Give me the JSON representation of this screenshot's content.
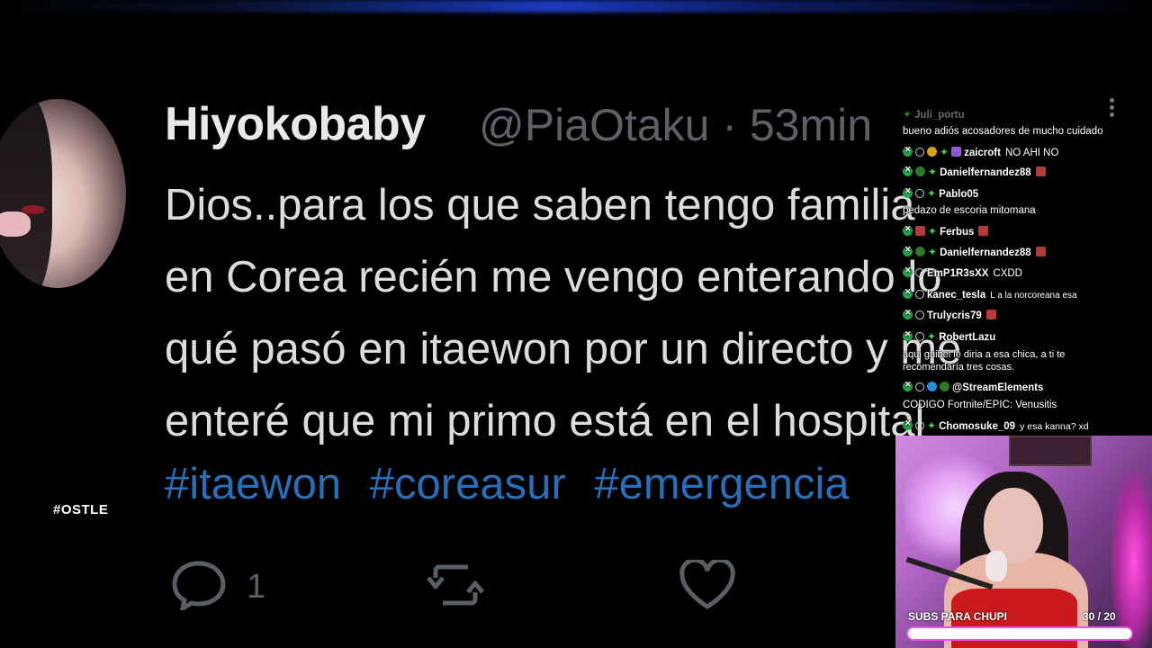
{
  "tweet": {
    "display_name": "Hiyokobaby",
    "handle_time": "@PiaOtaku · 53min",
    "lines": [
      "Dios..para los que saben tengo familia",
      "en Corea recién me vengo enterando lo",
      "qué pasó en itaewon por un directo y me",
      "enteré que mi primo está en el hospital"
    ],
    "hashtags": [
      "#itaewon",
      "#coreasur",
      "#emergencia"
    ],
    "reply_count": "1",
    "icons": [
      "reply-icon",
      "retweet-icon",
      "like-icon"
    ]
  },
  "side_tag": "#OSTLE",
  "chat": {
    "messages": [
      {
        "user": "Juli_portu",
        "text": ""
      },
      {
        "user": "",
        "text": "bueno adiós acosadores de mucho cuidado"
      },
      {
        "user": "zaicroft",
        "text": "NO AHI NO"
      },
      {
        "user": "Danielfernandez88",
        "text": ""
      },
      {
        "user": "Pablo05",
        "text": ""
      },
      {
        "user": "",
        "text": "pedazo de escoria mitomana"
      },
      {
        "user": "Ferbus",
        "text": ""
      },
      {
        "user": "Danielfernandez88",
        "text": ""
      },
      {
        "user": "EmP1R3sXX",
        "text": "CXDD"
      },
      {
        "user": "kanec_tesla",
        "text": "L a la norcoreana esa"
      },
      {
        "user": "Trulycris79",
        "text": ""
      },
      {
        "user": "RobertLazu",
        "text": ""
      },
      {
        "user": "",
        "text": "aqui guibel le diria a esa chica, a ti te"
      },
      {
        "user": "",
        "text": "recomendaría tres cosas."
      },
      {
        "user": "@StreamElements",
        "text": ""
      },
      {
        "user": "",
        "text": "CODIGO Fortnite/EPIC: Venusitis"
      },
      {
        "user": "Chomosuke_09",
        "text": "y esa kanna? xd"
      }
    ]
  },
  "subs": {
    "label": "SUBS PARA CHUPI",
    "count": "30  / 20",
    "progress": 1.0,
    "accent": "#e45ad8"
  },
  "colors": {
    "hashtag": "#2a6db8",
    "mod_badge": "#1ea64b"
  }
}
